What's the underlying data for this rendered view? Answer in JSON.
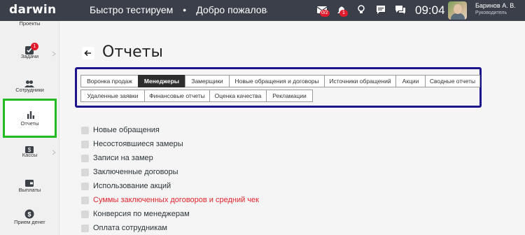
{
  "topbar": {
    "logo": "darwin",
    "ticker": [
      "Быстро тестируем",
      "Добро пожаловать в си"
    ],
    "ticker_dot": "•",
    "mail_badge": "0/2",
    "notif_badge": "1",
    "clock": "09:04",
    "user_name": "Баринов А. В.",
    "user_role": "Руководитель"
  },
  "sidebar": {
    "items": [
      {
        "label": "Проекты",
        "icon": "projects-icon"
      },
      {
        "label": "Задачи",
        "icon": "tasks-icon",
        "badge": "1"
      },
      {
        "label": "Сотрудники",
        "icon": "users-icon"
      },
      {
        "label": "Отчеты",
        "icon": "bar-chart-icon",
        "active": true
      },
      {
        "label": "Кассы",
        "icon": "cash-icon"
      },
      {
        "label": "Выплаты",
        "icon": "wallet-icon"
      },
      {
        "label": "Прием денег",
        "icon": "dollar-icon"
      }
    ]
  },
  "main": {
    "title": "Отчеты",
    "tabs": [
      "Воронка продаж",
      "Менеджеры",
      "Замерщики",
      "Новые обращения и договоры",
      "Источники обращений",
      "Акции",
      "Сводные отчеты",
      "Удаленные заявки",
      "Финансовые отчеты",
      "Оценка качества",
      "Рекламации"
    ],
    "active_tab": "Менеджеры",
    "reports": [
      "Новые обращения",
      "Несостоявшиеся замеры",
      "Записи на замер",
      "Заключенные договоры",
      "Использование акций",
      "Суммы заключенных договоров и средний чек",
      "Конверсия по менеджерам",
      "Оплата сотрудникам"
    ],
    "highlighted_report": "Суммы заключенных договоров и средний чек"
  },
  "colors": {
    "topbar": "#3a3f4a",
    "active_sidebar_border": "#22bb22",
    "tabs_box_border": "#1c148c",
    "active_tab": "#2e2e2e",
    "highlight_text": "#e0242c",
    "badge": "#e21b2c"
  }
}
